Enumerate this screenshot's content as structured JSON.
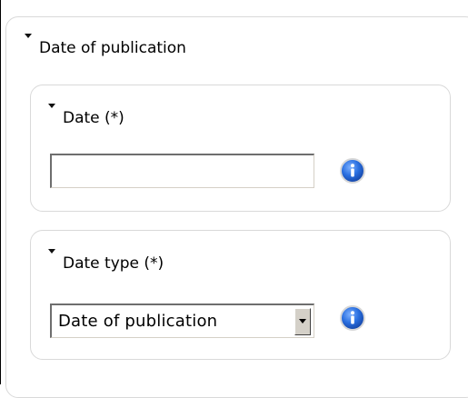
{
  "form": {
    "section": {
      "title": "Date of publication"
    },
    "date_field": {
      "label": "Date (*)",
      "value": "",
      "info_icon": "info-icon"
    },
    "date_type_field": {
      "label": "Date type (*)",
      "selected": "Date of publication",
      "info_icon": "info-icon"
    }
  },
  "colors": {
    "panel_border": "#d9d9d9",
    "info_icon_blue": "#1f5fd6"
  }
}
